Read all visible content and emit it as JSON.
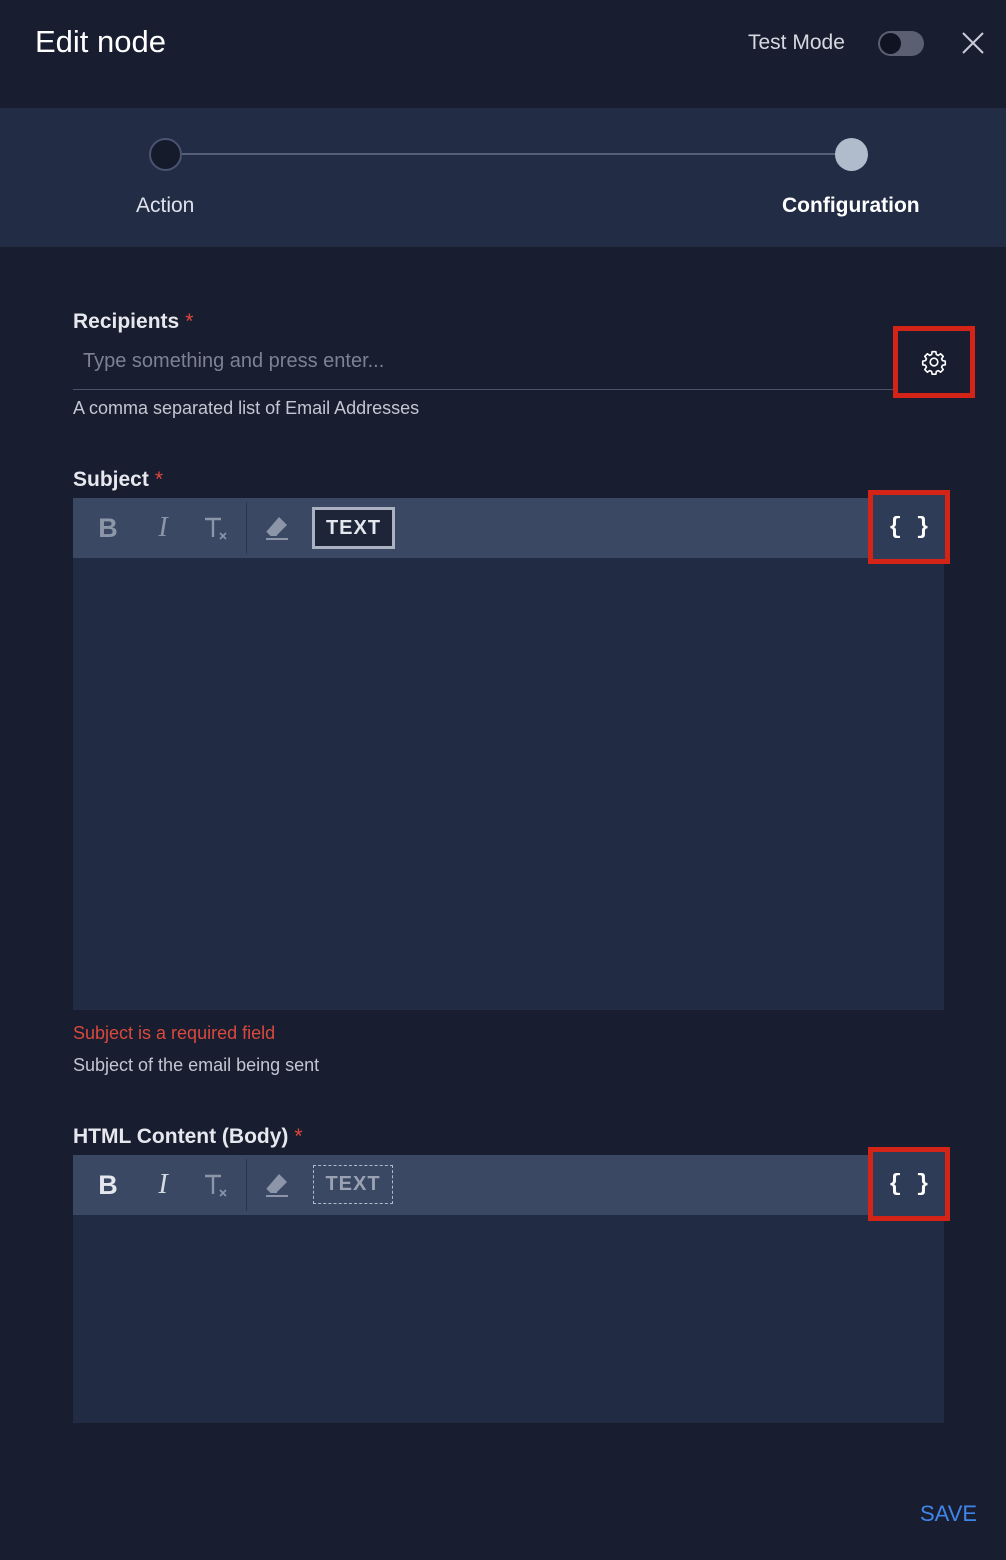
{
  "header": {
    "title": "Edit node",
    "test_mode_label": "Test Mode",
    "test_mode_on": false
  },
  "stepper": {
    "steps": [
      {
        "label": "Action"
      },
      {
        "label": "Configuration"
      }
    ],
    "active_step": 1
  },
  "recipients": {
    "label": "Recipients",
    "required_mark": "*",
    "placeholder": "Type something and press enter...",
    "value": "",
    "help": "A comma separated list of Email Addresses",
    "settings_icon": "gear-icon"
  },
  "subject": {
    "label": "Subject",
    "required_mark": "*",
    "toolbar": {
      "bold": "B",
      "italic": "I",
      "text_button": "TEXT",
      "variables": "{ }"
    },
    "error": "Subject is a required field",
    "help": "Subject of the email being sent"
  },
  "body": {
    "label": "HTML Content (Body)",
    "required_mark": "*",
    "toolbar": {
      "bold": "B",
      "italic": "I",
      "text_button": "TEXT",
      "variables": "{ }"
    }
  },
  "footer": {
    "save_label": "SAVE"
  },
  "colors": {
    "background": "#181d2f",
    "panel": "#222c45",
    "toolbar": "#3a4863",
    "highlight": "#d42418",
    "error": "#d9493d",
    "accent": "#3f85ea"
  }
}
